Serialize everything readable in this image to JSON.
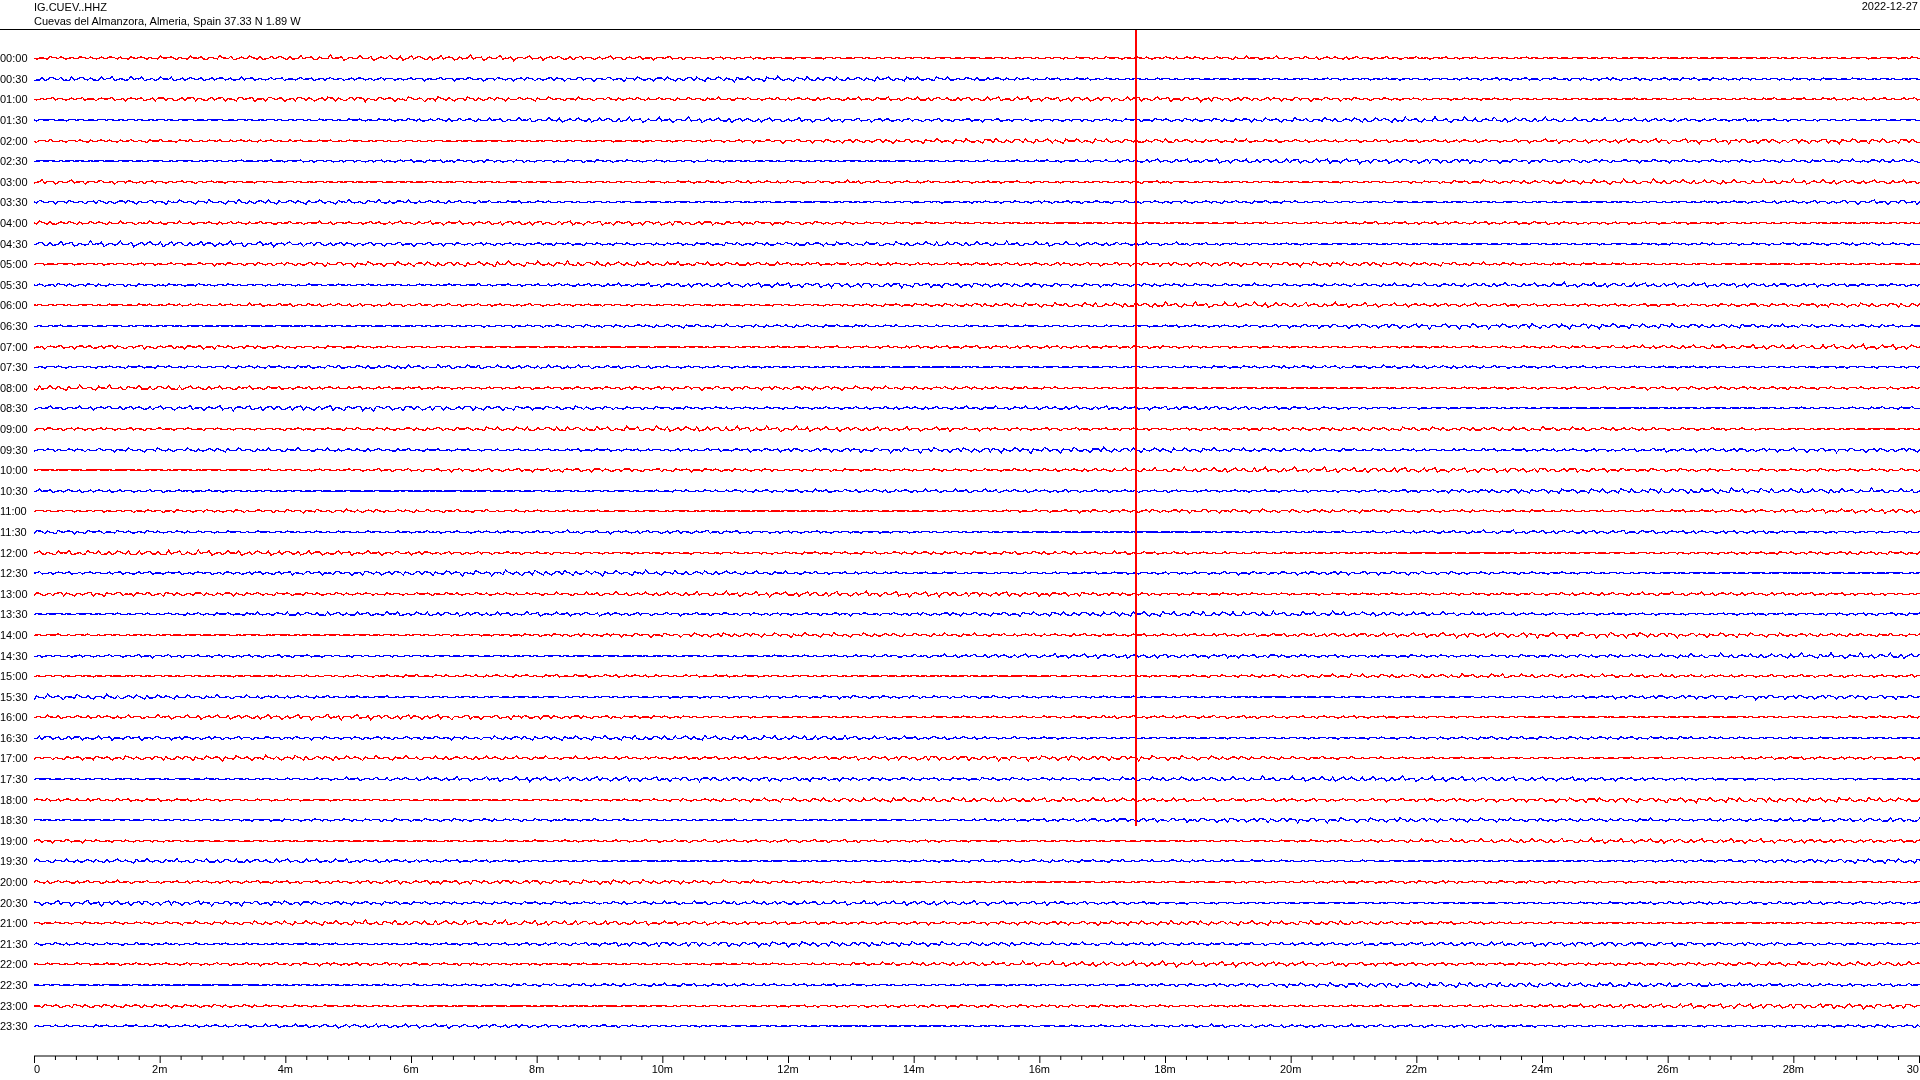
{
  "header": {
    "station": "IG.CUEV..HHZ",
    "location": "Cuevas del Almanzora, Almeria, Spain  37.33 N 1.89 W",
    "date": "2022-12-27"
  },
  "rows": [
    {
      "label": "00:00",
      "color": "#ff0000"
    },
    {
      "label": "00:30",
      "color": "#0000ff"
    },
    {
      "label": "01:00",
      "color": "#ff0000"
    },
    {
      "label": "01:30",
      "color": "#0000ff"
    },
    {
      "label": "02:00",
      "color": "#ff0000"
    },
    {
      "label": "02:30",
      "color": "#0000ff"
    },
    {
      "label": "03:00",
      "color": "#ff0000"
    },
    {
      "label": "03:30",
      "color": "#0000ff"
    },
    {
      "label": "04:00",
      "color": "#ff0000"
    },
    {
      "label": "04:30",
      "color": "#0000ff"
    },
    {
      "label": "05:00",
      "color": "#ff0000"
    },
    {
      "label": "05:30",
      "color": "#0000ff"
    },
    {
      "label": "06:00",
      "color": "#ff0000"
    },
    {
      "label": "06:30",
      "color": "#0000ff"
    },
    {
      "label": "07:00",
      "color": "#ff0000"
    },
    {
      "label": "07:30",
      "color": "#0000ff"
    },
    {
      "label": "08:00",
      "color": "#ff0000"
    },
    {
      "label": "08:30",
      "color": "#0000ff"
    },
    {
      "label": "09:00",
      "color": "#ff0000"
    },
    {
      "label": "09:30",
      "color": "#0000ff"
    },
    {
      "label": "10:00",
      "color": "#ff0000"
    },
    {
      "label": "10:30",
      "color": "#0000ff"
    },
    {
      "label": "11:00",
      "color": "#ff0000"
    },
    {
      "label": "11:30",
      "color": "#0000ff"
    },
    {
      "label": "12:00",
      "color": "#ff0000"
    },
    {
      "label": "12:30",
      "color": "#0000ff"
    },
    {
      "label": "13:00",
      "color": "#ff0000"
    },
    {
      "label": "13:30",
      "color": "#0000ff"
    },
    {
      "label": "14:00",
      "color": "#ff0000"
    },
    {
      "label": "14:30",
      "color": "#0000ff"
    },
    {
      "label": "15:00",
      "color": "#ff0000"
    },
    {
      "label": "15:30",
      "color": "#0000ff"
    },
    {
      "label": "16:00",
      "color": "#ff0000"
    },
    {
      "label": "16:30",
      "color": "#0000ff"
    },
    {
      "label": "17:00",
      "color": "#ff0000"
    },
    {
      "label": "17:30",
      "color": "#0000ff"
    },
    {
      "label": "18:00",
      "color": "#ff0000"
    },
    {
      "label": "18:30",
      "color": "#0000ff"
    },
    {
      "label": "19:00",
      "color": "#ff0000"
    },
    {
      "label": "19:30",
      "color": "#0000ff"
    },
    {
      "label": "20:00",
      "color": "#ff0000"
    },
    {
      "label": "20:30",
      "color": "#0000ff"
    },
    {
      "label": "21:00",
      "color": "#ff0000"
    },
    {
      "label": "21:30",
      "color": "#0000ff"
    },
    {
      "label": "22:00",
      "color": "#ff0000"
    },
    {
      "label": "22:30",
      "color": "#0000ff"
    },
    {
      "label": "23:00",
      "color": "#ff0000"
    },
    {
      "label": "23:30",
      "color": "#0000ff"
    }
  ],
  "axis": {
    "labels": [
      "0",
      "2m",
      "4m",
      "6m",
      "8m",
      "10m",
      "12m",
      "14m",
      "16m",
      "18m",
      "20m",
      "22m",
      "24m",
      "26m",
      "28m",
      "30"
    ]
  }
}
